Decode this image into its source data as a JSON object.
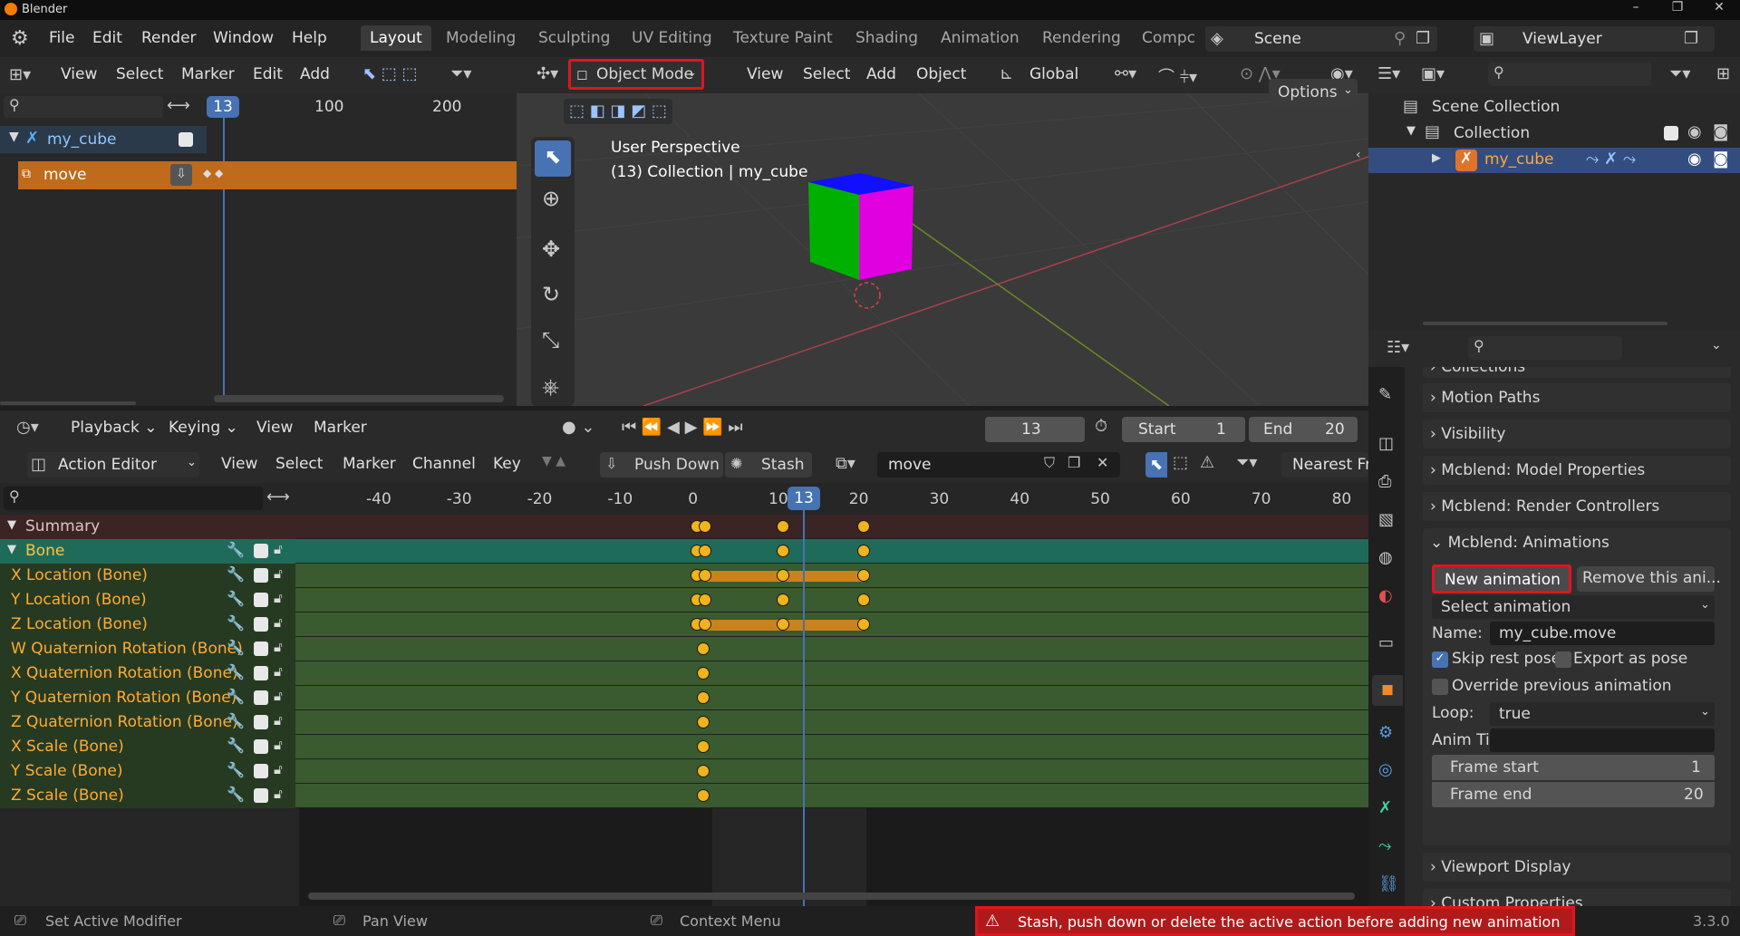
{
  "window": {
    "title": "Blender"
  },
  "menus": [
    "File",
    "Edit",
    "Render",
    "Window",
    "Help"
  ],
  "workspaces": [
    "Layout",
    "Modeling",
    "Sculpting",
    "UV Editing",
    "Texture Paint",
    "Shading",
    "Animation",
    "Rendering",
    "Compc"
  ],
  "scene": "Scene",
  "viewlayer": "ViewLayer",
  "nla": {
    "menu": [
      "View",
      "Select",
      "Marker",
      "Edit",
      "Add"
    ],
    "frame": "13",
    "ticks": [
      "100",
      "200"
    ],
    "track": "my_cube",
    "strip": "move"
  },
  "viewport": {
    "mode": "Object Mode",
    "menu": [
      "View",
      "Select",
      "Add",
      "Object"
    ],
    "orientation": "Global",
    "options": "Options",
    "info1": "User Perspective",
    "info2": "(13) Collection | my_cube"
  },
  "outliner": {
    "scene_collection": "Scene Collection",
    "collection": "Collection",
    "object": "my_cube"
  },
  "timeline": {
    "menu": [
      "Playback",
      "Keying",
      "View",
      "Marker"
    ],
    "current": "13",
    "start_label": "Start",
    "start": "1",
    "end_label": "End",
    "end": "20"
  },
  "action": {
    "editor": "Action Editor",
    "menu": [
      "View",
      "Select",
      "Marker",
      "Channel",
      "Key"
    ],
    "push_down": "Push Down",
    "stash": "Stash",
    "action_name": "move",
    "snap": "Nearest Fr",
    "ticks": [
      "-40",
      "-30",
      "-20",
      "-10",
      "0",
      "10",
      "20",
      "30",
      "40",
      "50",
      "60",
      "70",
      "80"
    ],
    "current": "13",
    "channels": [
      "Summary",
      "Bone",
      "X Location (Bone)",
      "Y Location (Bone)",
      "Z Location (Bone)",
      "W Quaternion Rotation (Bone)",
      "X Quaternion Rotation (Bone)",
      "Y Quaternion Rotation (Bone)",
      "Z Quaternion Rotation (Bone)",
      "X Scale (Bone)",
      "Y Scale (Bone)",
      "Z Scale (Bone)"
    ]
  },
  "props": {
    "panels_top": [
      "Collections",
      "Motion Paths",
      "Visibility",
      "Mcblend: Model Properties",
      "Mcblend: Render Controllers",
      "Mcblend: Animations"
    ],
    "new_anim": "New animation",
    "remove_anim": "Remove this ani...",
    "select_anim": "Select animation",
    "name_label": "Name:",
    "name_value": "my_cube.move",
    "skip_rest": "Skip rest poses",
    "export_pose": "Export as pose",
    "override": "Override previous animation",
    "loop_label": "Loop:",
    "loop_value": "true",
    "anim_time_label": "Anim Ti...",
    "frame_start_label": "Frame start",
    "frame_start": "1",
    "frame_end_label": "Frame end",
    "frame_end": "20",
    "panels_bottom": [
      "Viewport Display",
      "Custom Properties"
    ]
  },
  "status": {
    "left1": "Set Active Modifier",
    "left2": "Pan View",
    "left3": "Context Menu",
    "warning": "Stash, push down or delete the active action before adding new animation",
    "version": "3.3.0"
  }
}
